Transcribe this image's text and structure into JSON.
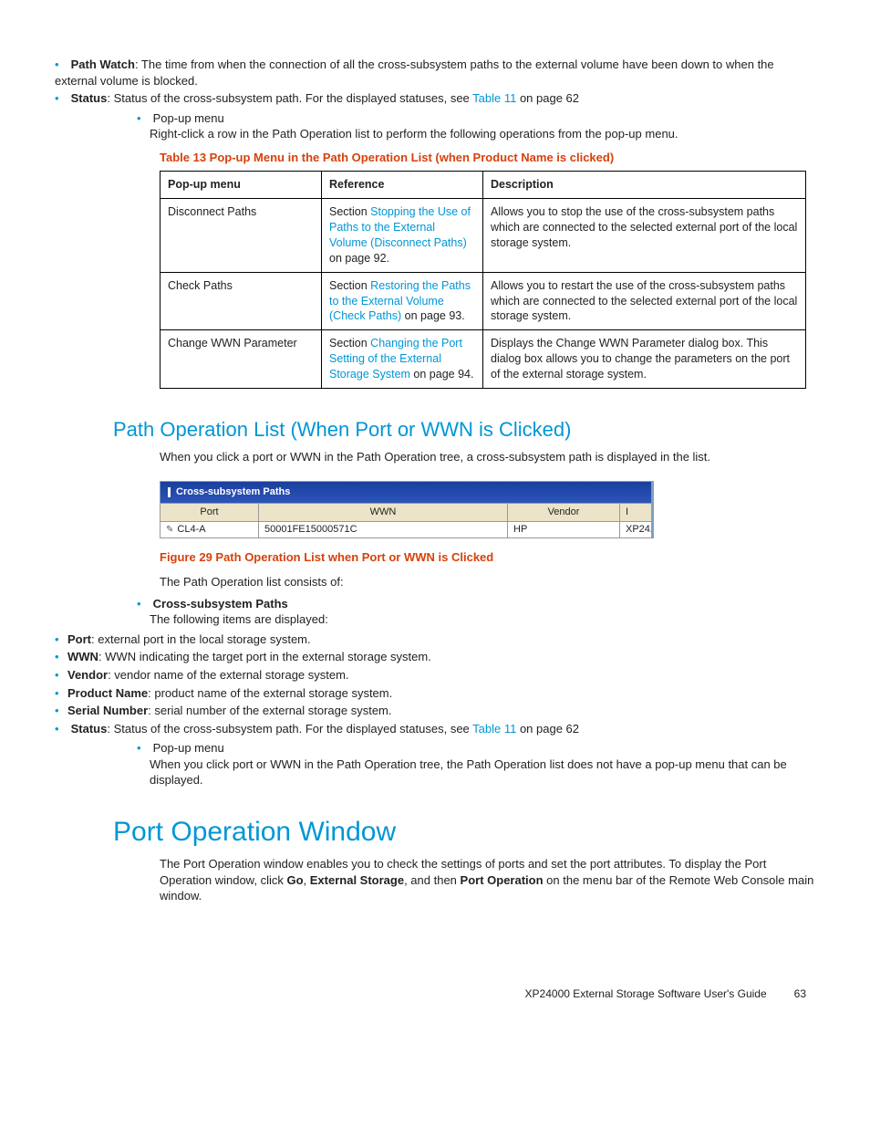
{
  "top_bullets": {
    "path_watch_label": "Path Watch",
    "path_watch_text": ": The time from when the connection of all the cross-subsystem paths to the external volume have been down to when the external volume is blocked.",
    "status_label": "Status",
    "status_text_pre": ": Status of the cross-subsystem path. For the displayed statuses, see ",
    "status_link": "Table 11",
    "status_text_post": " on page 62"
  },
  "popup_menu": {
    "label": "Pop-up menu",
    "text": "Right-click a row in the Path Operation list to perform the following operations from the pop-up menu."
  },
  "table13": {
    "caption": "Table 13 Pop-up Menu in the Path Operation List (when Product Name is clicked)",
    "h1": "Pop-up menu",
    "h2": "Reference",
    "h3": "Description",
    "rows": [
      {
        "menu": "Disconnect Paths",
        "ref_pre": "Section ",
        "ref_link": "Stopping the Use of Paths to the External Volume (Disconnect Paths)",
        "ref_post": " on page 92.",
        "desc": "Allows you to stop the use of the cross-subsystem paths which are connected to the selected external port of the local storage system."
      },
      {
        "menu": "Check Paths",
        "ref_pre": "Section ",
        "ref_link": "Restoring the Paths to the External Volume (Check Paths)",
        "ref_post": " on page 93.",
        "desc": "Allows you to restart the use of the cross-subsystem paths which are connected to the selected external port of the local storage system."
      },
      {
        "menu": "Change WWN Parameter",
        "ref_pre": "Section ",
        "ref_link": "Changing the Port Setting of the External Storage System",
        "ref_post": " on page 94.",
        "desc": "Displays the Change WWN Parameter dialog box. This dialog box allows you to change the parameters on the port of the external storage system."
      }
    ]
  },
  "section_path_list": {
    "heading": "Path Operation List (When Port or WWN is Clicked)",
    "intro": "When you click a port or WWN in the Path Operation tree, a cross-subsystem path is displayed in the list."
  },
  "screenshot": {
    "title": "Cross-subsystem Paths",
    "cols": {
      "port": "Port",
      "wwn": "WWN",
      "vendor": "Vendor",
      "last": "I"
    },
    "row": {
      "port": "CL4-A",
      "wwn": "50001FE15000571C",
      "vendor": "HP",
      "last": "XP24"
    }
  },
  "figure29": "Figure 29 Path Operation List when Port or WWN is Clicked",
  "path_list_desc": {
    "intro": "The Path Operation list consists of:",
    "csp_label": "Cross-subsystem Paths",
    "csp_text": "The following items are displayed:",
    "items": [
      {
        "label": "Port",
        "text": ": external port in the local storage system."
      },
      {
        "label": "WWN",
        "text": ": WWN indicating the target port in the external storage system."
      },
      {
        "label": "Vendor",
        "text": ": vendor name of the external storage system."
      },
      {
        "label": "Product Name",
        "text": ": product name of the external storage system."
      },
      {
        "label": "Serial Number",
        "text": ": serial number of the external storage system."
      }
    ],
    "status_label": "Status",
    "status_pre": ": Status of the cross-subsystem path. For the displayed statuses, see ",
    "status_link": "Table 11",
    "status_post": " on page 62",
    "popup_label": "Pop-up menu",
    "popup_text": "When you click port or WWN in the Path Operation tree, the Path Operation list does not have a pop-up menu that can be displayed."
  },
  "section_port_op": {
    "heading": "Port Operation Window",
    "text_pre": "The Port Operation window enables you to check the settings of ports and set the port attributes. To display the Port Operation window, click ",
    "go": "Go",
    "comma1": ", ",
    "ext": "External Storage",
    "comma2": ", and then ",
    "portop": "Port Operation",
    "text_post": " on the menu bar of the Remote Web Console main window."
  },
  "footer": {
    "doc": "XP24000 External Storage Software User's Guide",
    "page": "63"
  }
}
